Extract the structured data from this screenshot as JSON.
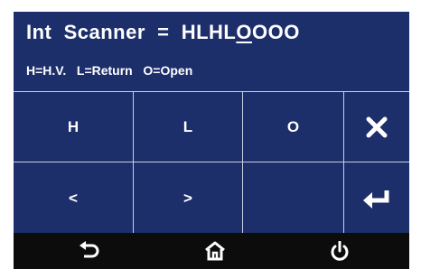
{
  "header": {
    "title_prefix": "Int  Scanner  =  HLHL",
    "title_cursor_char": "O",
    "title_suffix": "OOO",
    "legend": "H=H.V.   L=Return   O=Open"
  },
  "keypad": {
    "row1": [
      "H",
      "L",
      "O"
    ],
    "row2": [
      "<",
      ">",
      ""
    ],
    "side_icons": [
      "close-icon",
      "enter-icon"
    ]
  },
  "footer": {
    "icons": [
      "back-icon",
      "home-icon",
      "power-icon"
    ]
  },
  "colors": {
    "panel": "#1d2f6b",
    "footer": "#0c0c0c",
    "divider": "#c9cfe0",
    "text": "#ffffff"
  }
}
